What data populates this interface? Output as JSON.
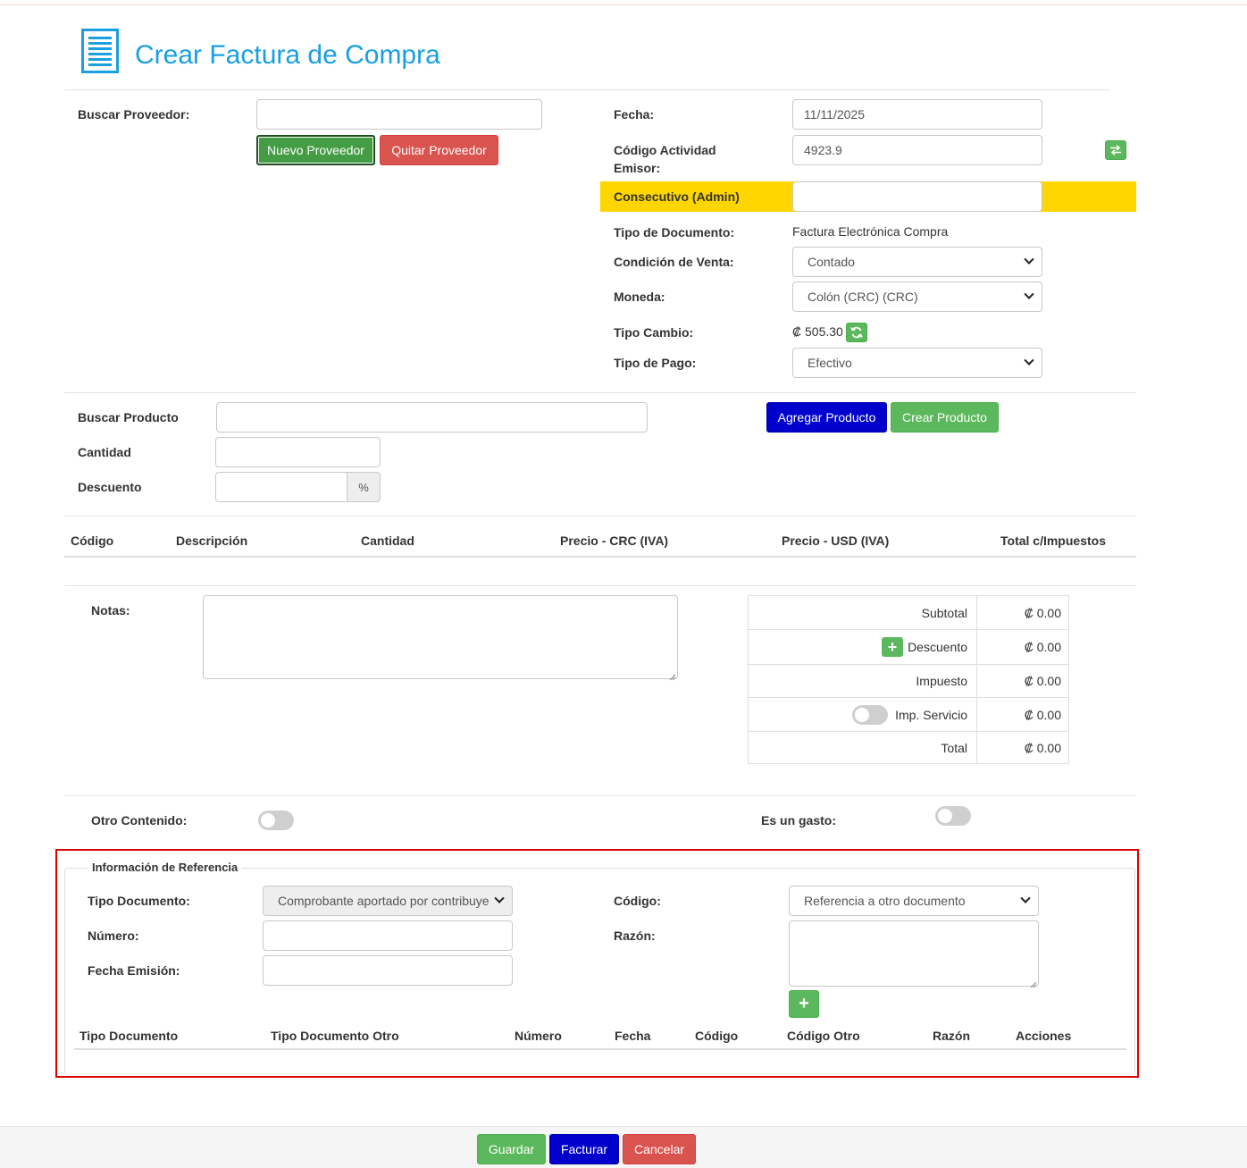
{
  "header": {
    "title": "Crear Factura de Compra",
    "icon": "document-list-icon"
  },
  "proveedor": {
    "search_label": "Buscar Proveedor:",
    "search_value": "",
    "new_button": "Nuevo Proveedor",
    "remove_button": "Quitar Proveedor"
  },
  "invoice": {
    "fecha_label": "Fecha:",
    "fecha_value": "11/11/2025",
    "actividad_label_1": "Código Actividad",
    "actividad_label_2": "Emisor:",
    "actividad_value": "4923.9",
    "consecutivo_label": "Consecutivo (Admin)",
    "consecutivo_value": "",
    "tipo_doc_label": "Tipo de Documento:",
    "tipo_doc_value": "Factura Electrónica Compra",
    "condicion_label": "Condición de Venta:",
    "condicion_value": "Contado",
    "moneda_label": "Moneda:",
    "moneda_value": "Colón (CRC) (CRC)",
    "tipo_cambio_label": "Tipo Cambio:",
    "tipo_cambio_value": "₡ 505.30",
    "tipo_pago_label": "Tipo de Pago:",
    "tipo_pago_value": "Efectivo"
  },
  "producto": {
    "search_label": "Buscar Producto",
    "cantidad_label": "Cantidad",
    "descuento_label": "Descuento",
    "percent_addon": "%",
    "add_button": "Agregar Producto",
    "create_button": "Crear Producto"
  },
  "items_table": {
    "columns": [
      "Código",
      "Descripción",
      "Cantidad",
      "Precio - CRC (IVA)",
      "Precio - USD (IVA)",
      "Total c/Impuestos"
    ]
  },
  "notas": {
    "label": "Notas:",
    "value": ""
  },
  "totals": {
    "subtotal_label": "Subtotal",
    "subtotal_value": "₡ 0.00",
    "descuento_label": "Descuento",
    "descuento_value": "₡ 0.00",
    "impuesto_label": "Impuesto",
    "impuesto_value": "₡ 0.00",
    "servicio_label": "Imp. Servicio",
    "servicio_value": "₡ 0.00",
    "total_label": "Total",
    "total_value": "₡ 0.00"
  },
  "options": {
    "otro_contenido_label": "Otro Contenido:",
    "gasto_label": "Es un gasto:"
  },
  "referencia": {
    "legend": "Información de Referencia",
    "tipo_doc_label": "Tipo Documento:",
    "tipo_doc_value": "Comprobante aportado por contribuye",
    "numero_label": "Número:",
    "fecha_label": "Fecha Emisión:",
    "codigo_label": "Código:",
    "codigo_value": "Referencia a otro documento",
    "razon_label": "Razón:",
    "columns": [
      "Tipo Documento",
      "Tipo Documento Otro",
      "Número",
      "Fecha",
      "Código",
      "Código Otro",
      "Razón",
      "Acciones"
    ]
  },
  "footer": {
    "save": "Guardar",
    "invoice": "Facturar",
    "cancel": "Cancelar"
  },
  "colors": {
    "title_blue": "#1a9fe0",
    "consecutivo_yellow": "#ffd500",
    "highlight_red": "#dd0000"
  }
}
